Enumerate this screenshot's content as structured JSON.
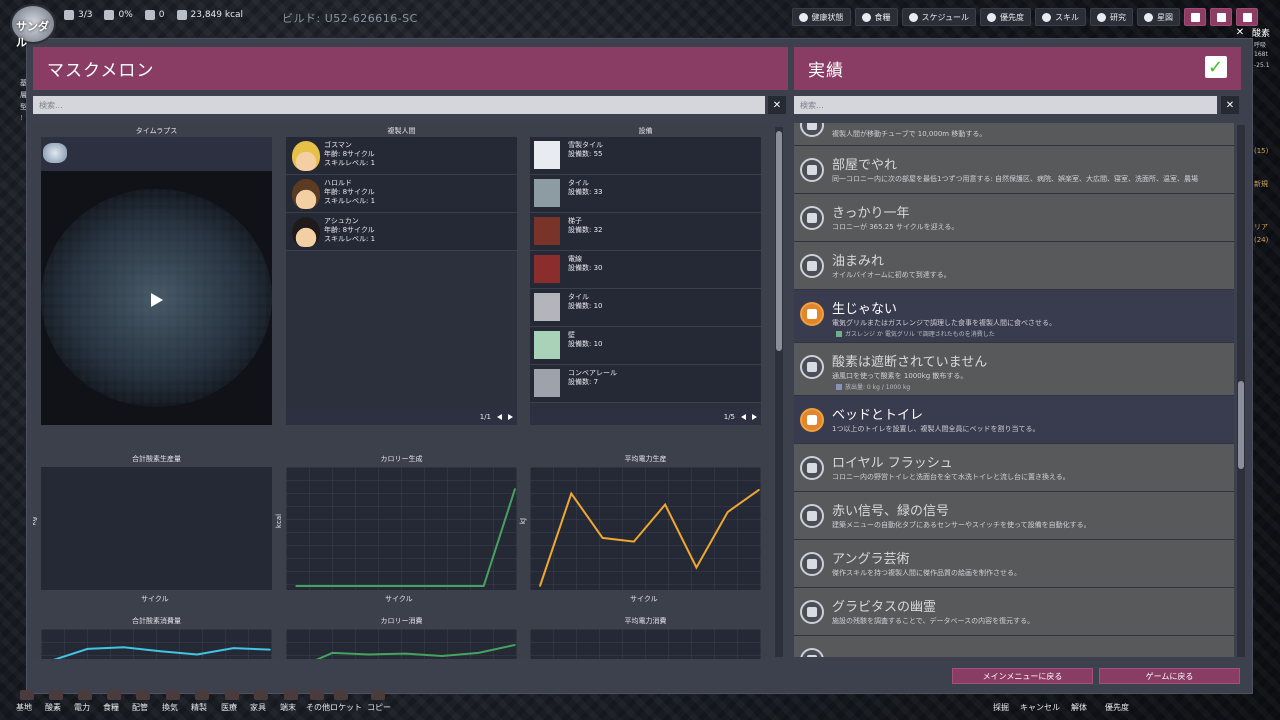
{
  "top_hud": {
    "colony_name": "サンダル",
    "duplicants": "3/3",
    "stress": "0%",
    "alerts": "0",
    "calories": "23,849 kcal",
    "build": "ビルド: U52-626616-SC",
    "buttons": [
      {
        "label": "健康状態",
        "icon": "heart-icon"
      },
      {
        "label": "食糧",
        "icon": "food-icon"
      },
      {
        "label": "スケジュール",
        "icon": "clock-icon"
      },
      {
        "label": "優先度",
        "icon": "priority-icon"
      },
      {
        "label": "スキル",
        "icon": "wrench-icon"
      },
      {
        "label": "研究",
        "icon": "research-icon"
      },
      {
        "label": "星図",
        "icon": "rocket-icon"
      }
    ]
  },
  "right_edge": {
    "title": "酸素",
    "rows": [
      "呼吸",
      "168t",
      "-25.1"
    ],
    "notes": [
      "(15)",
      "新規",
      "リア",
      "(24)"
    ]
  },
  "left_edge": {
    "rows": [
      "基",
      "層",
      "型",
      "!"
    ]
  },
  "colony_report": {
    "title": "マスクメロン",
    "search_placeholder": "検索...",
    "timelapse_title": "タイムラプス",
    "duplicants_title": "複製人間",
    "buildings_title": "設備",
    "duplicants": [
      {
        "name": "ゴスマン",
        "age": "年齢: 8サイクル",
        "skill": "スキルレベル: 1",
        "color": "#e7c048"
      },
      {
        "name": "ハロルド",
        "age": "年齢: 8サイクル",
        "skill": "スキルレベル: 1",
        "color": "#5b3b24"
      },
      {
        "name": "アシュカン",
        "age": "年齢: 8サイクル",
        "skill": "スキルレベル: 1",
        "color": "#1f1b1b"
      }
    ],
    "dup_pager": "1/1",
    "buildings": [
      {
        "name": "雪製タイル",
        "count": "設備数: 55",
        "color": "#e8ecf0"
      },
      {
        "name": "タイル",
        "count": "設備数: 33",
        "color": "#8d9ba3"
      },
      {
        "name": "梯子",
        "count": "設備数: 32",
        "color": "#7a3328"
      },
      {
        "name": "電線",
        "count": "設備数: 30",
        "color": "#8b2d2d"
      },
      {
        "name": "タイル",
        "count": "設備数: 10",
        "color": "#b3b5bb"
      },
      {
        "name": "壁",
        "count": "設備数: 10",
        "color": "#a8d3b8"
      },
      {
        "name": "コンベアレール",
        "count": "設備数: 7",
        "color": "#9ea2aa"
      }
    ],
    "bld_pager": "1/5",
    "graphs_row1": [
      {
        "title": "合計酸素生産量",
        "ylabel": "kg",
        "xlabel": "サイクル"
      },
      {
        "title": "カロリー生成",
        "ylabel": "kcal",
        "xlabel": "サイクル"
      },
      {
        "title": "平均電力生産",
        "ylabel": "kJ",
        "xlabel": "サイクル"
      }
    ],
    "graphs_row2": [
      {
        "title": "合計酸素消費量"
      },
      {
        "title": "カロリー消費"
      },
      {
        "title": "平均電力消費"
      }
    ]
  },
  "achievements": {
    "title": "実績",
    "search_placeholder": "検索...",
    "items": [
      {
        "title": "",
        "desc": "複製人間が移動チューブで 10,000m 移動する。",
        "done": false
      },
      {
        "title": "部屋でやれ",
        "desc": "同一コロニー内に次の部屋を最低1つずつ用意する: 自然保護区、病院、娯楽室、大広間、寝室、洗面所、温室、農場",
        "done": false
      },
      {
        "title": "きっかり一年",
        "desc": "コロニーが 365.25 サイクルを迎える。",
        "done": false
      },
      {
        "title": "油まみれ",
        "desc": "オイルバイオームに初めて到達する。",
        "done": false
      },
      {
        "title": "生じゃない",
        "desc": "電気グリルまたはガスレンジで調理した食事を複製人間に食べさせる。",
        "sub": "ガスレンジ か 電気グリル で調理されたものを消費した",
        "sub_color": "#6fb08a",
        "done": true
      },
      {
        "title": "酸素は遮断されていません",
        "desc": "通風口を使って酸素を 1000kg 散布する。",
        "sub": "放出量: 0 kg / 1000 kg",
        "sub_color": "#8a91b8",
        "done": false
      },
      {
        "title": "ベッドとトイレ",
        "desc": "1つ以上のトイレを設置し、複製人間全員にベッドを割り当てる。",
        "done": true
      },
      {
        "title": "ロイヤル フラッシュ",
        "desc": "コロニー内の野営トイレと洗面台を全て水洗トイレと流し台に置き換える。",
        "done": false
      },
      {
        "title": "赤い信号、緑の信号",
        "desc": "建築メニューの自動化タブにあるセンサーやスイッチを使って設備を自動化する。",
        "done": false
      },
      {
        "title": "アングラ芸術",
        "desc": "傑作スキルを持つ複製人間に傑作品質の絵画を制作させる。",
        "done": false
      },
      {
        "title": "グラビタスの幽霊",
        "desc": "施設の残骸を調査することで、データベースの内容を復元する。",
        "done": false
      },
      {
        "title": "",
        "desc": "",
        "done": false
      }
    ]
  },
  "footer": {
    "main_menu": "メインメニューに戻る",
    "resume": "ゲームに戻る"
  },
  "bottom_bar": {
    "left": [
      "基地",
      "酸素",
      "電力",
      "食糧",
      "配管",
      "換気",
      "精製",
      "医療",
      "家具",
      "端末",
      "その他",
      "ロケット",
      "コピー"
    ],
    "right": [
      "採掘",
      "キャンセル",
      "解体",
      "優先度"
    ]
  },
  "chart_data": [
    {
      "type": "line",
      "title": "合計酸素生産量",
      "xlabel": "サイクル",
      "ylabel": "kg",
      "series": []
    },
    {
      "type": "line",
      "title": "カロリー生成",
      "xlabel": "サイクル",
      "ylabel": "kcal",
      "ylim": [
        0,
        8
      ],
      "x": [
        1,
        2,
        3,
        4,
        5,
        6,
        7,
        8
      ],
      "series": [
        {
          "values": [
            0,
            0,
            0,
            0,
            0,
            0,
            0,
            7
          ],
          "color": "#46a35e"
        }
      ]
    },
    {
      "type": "line",
      "title": "平均電力生産",
      "xlabel": "サイクル",
      "ylabel": "kJ",
      "ylim": [
        0,
        30
      ],
      "x": [
        1,
        2,
        3,
        4,
        5,
        6,
        7,
        8
      ],
      "series": [
        {
          "values": [
            0,
            25,
            13,
            12,
            22,
            5,
            20,
            26
          ],
          "color": "#f0a830"
        }
      ]
    },
    {
      "type": "line",
      "title": "合計酸素消費量",
      "series": [
        {
          "values": [
            110,
            125,
            127,
            122,
            118,
            126,
            124
          ],
          "color": "#40c5e3"
        }
      ],
      "ylim": [
        0,
        140
      ]
    },
    {
      "type": "line",
      "title": "カロリー消費",
      "series": [
        {
          "values": [
            100,
            120,
            118,
            119,
            116,
            120,
            130
          ],
          "color": "#46a35e"
        }
      ],
      "ylim": [
        0,
        140
      ]
    },
    {
      "type": "line",
      "title": "平均電力消費",
      "series": []
    }
  ]
}
